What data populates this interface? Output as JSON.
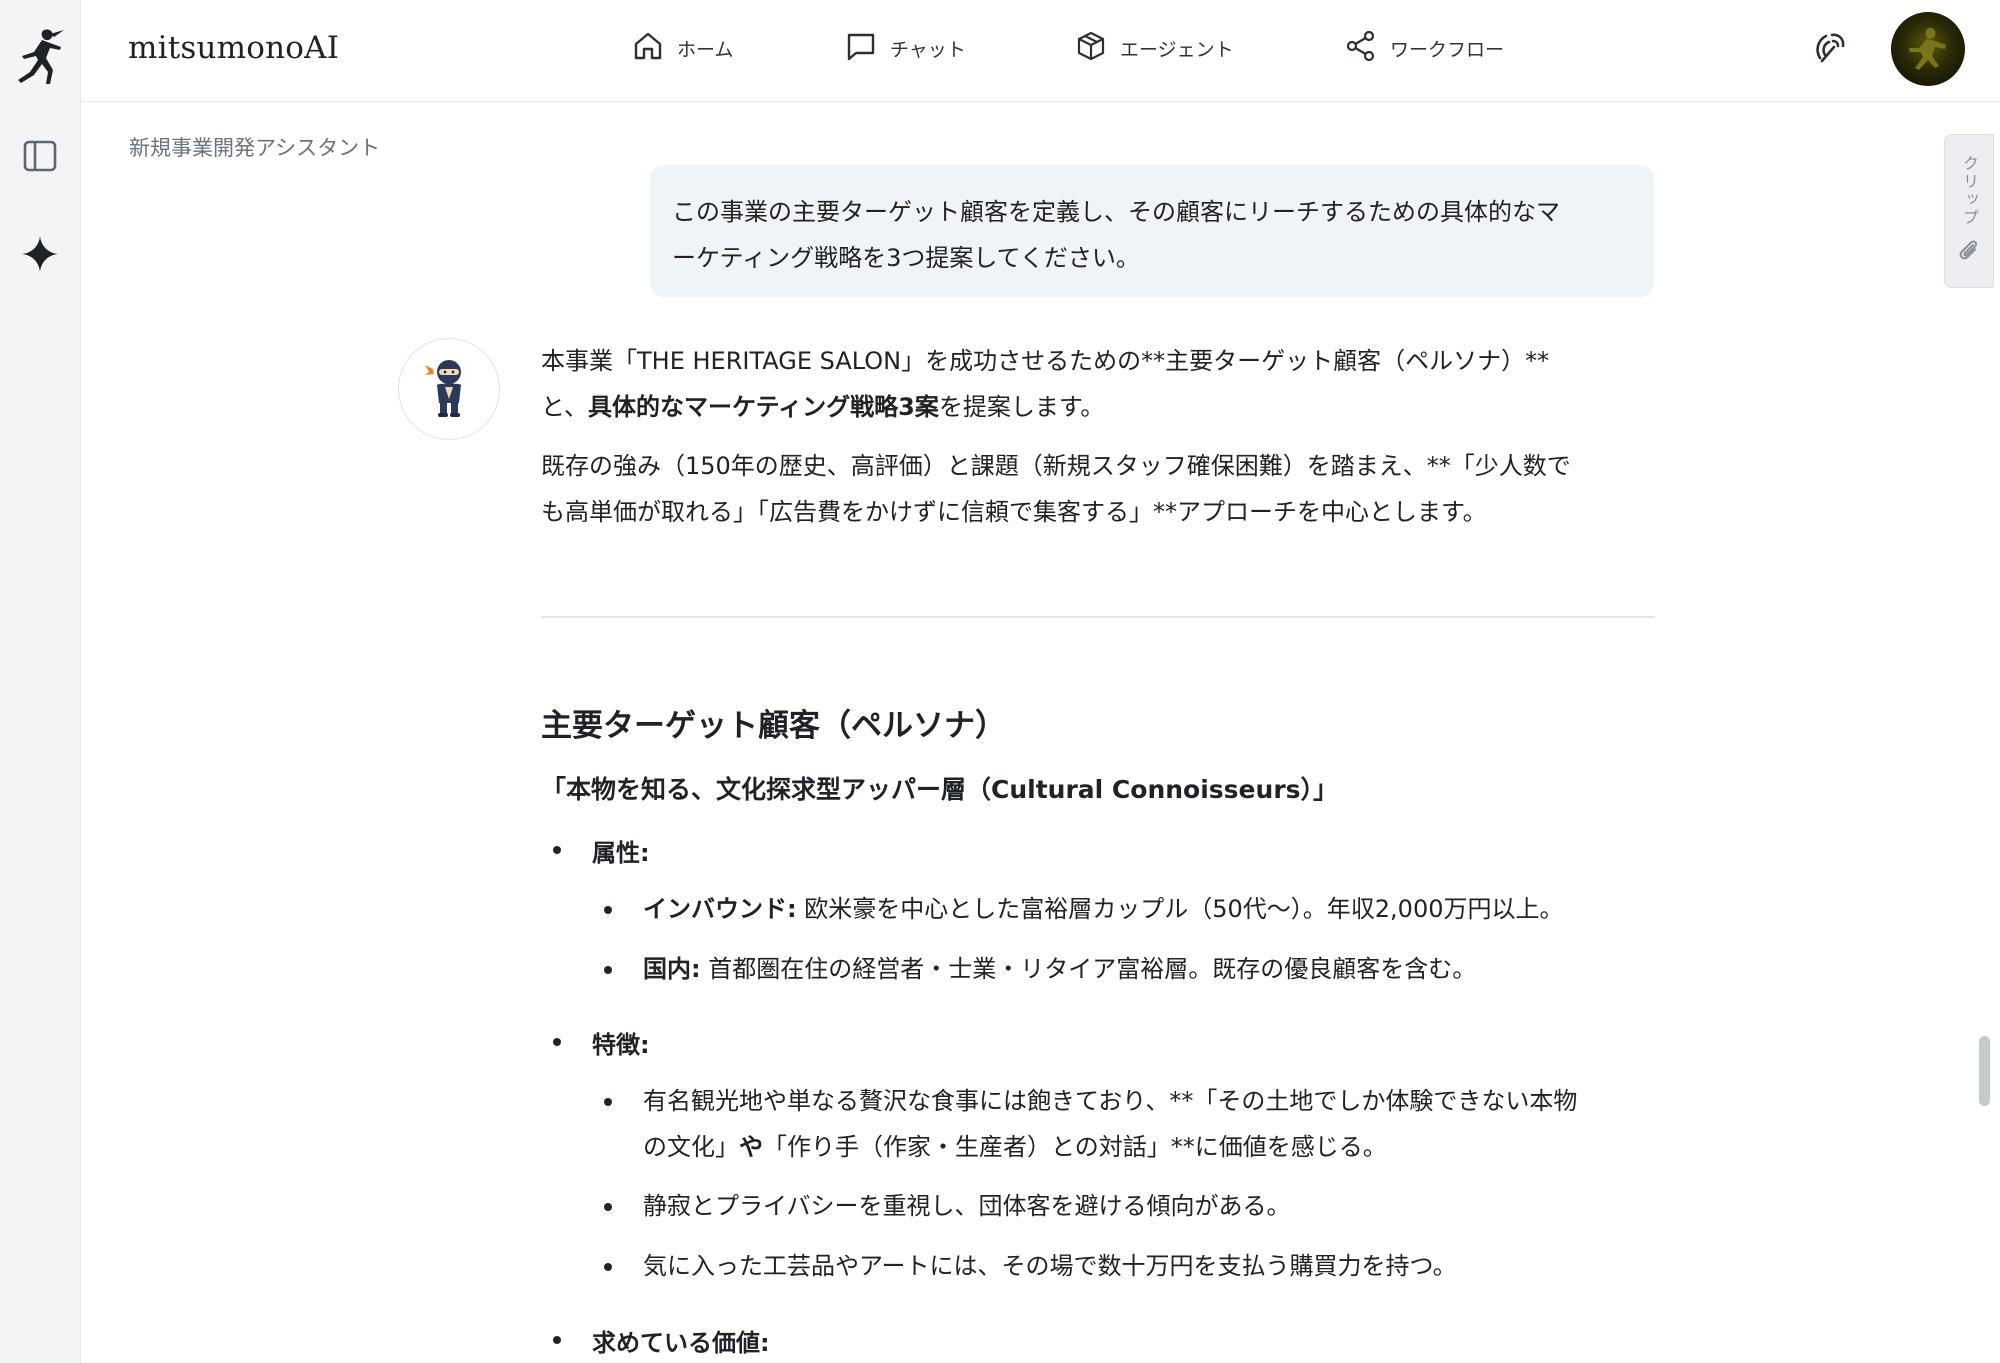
{
  "app": {
    "brand": "mitsumonoAI"
  },
  "nav": {
    "items": [
      {
        "label": "ホーム",
        "icon": "home-icon"
      },
      {
        "label": "チャット",
        "icon": "chat-icon"
      },
      {
        "label": "エージェント",
        "icon": "cube-icon"
      },
      {
        "label": "ワークフロー",
        "icon": "share-nodes-icon"
      }
    ]
  },
  "assistant": {
    "name": "新規事業開発アシスタント"
  },
  "clip": {
    "label": "クリップ"
  },
  "user_message": {
    "line1": "この事業の主要ターゲット顧客を定義し、その顧客にリーチするための具体的なマ",
    "line2": "ーケティング戦略を3つ提案してください。"
  },
  "answer": {
    "p1_line1": "本事業「THE HERITAGE SALON」を成功させるための**主要ターゲット顧客（ペルソナ）**",
    "p1_line2_pre": "と、",
    "p1_line2_bold": "具体的なマーケティング戦略3案",
    "p1_line2_post": "を提案します。",
    "p2_line1": "既存の強み（150年の歴史、高評価）と課題（新規スタッフ確保困難）を踏まえ、**「少人数で",
    "p2_line2": "も高単価が取れる」「広告費をかけずに信頼で集客する」**アプローチを中心とします。",
    "section_title": "主要ターゲット顧客（ペルソナ）",
    "persona_title": "「本物を知る、文化探求型アッパー層（Cultural Connoisseurs）」",
    "attr_head": "属性:",
    "inbound_label": "インバウンド:",
    "inbound_text": " 欧米豪を中心とした富裕層カップル（50代〜）。年収2,000万円以上。",
    "domestic_label": "国内:",
    "domestic_text": " 首都圏在住の経営者・士業・リタイア富裕層。既存の優良顧客を含む。",
    "feature_head": "特徴:",
    "feature1_line1": "有名観光地や単なる贅沢な食事には飽きており、**「その土地でしか体験できない本物",
    "feature1_line2_pre": "の文化」",
    "feature1_line2_bold": "や",
    "feature1_line2_post": "「作り手（作家・生産者）との対話」**に価値を感じる。",
    "feature2": "静寂とプライバシーを重視し、団体客を避ける傾向がある。",
    "feature3": "気に入った工芸品やアートには、その場で数十万円を支払う購買力を持つ。",
    "value_head": "求めている価値:"
  }
}
